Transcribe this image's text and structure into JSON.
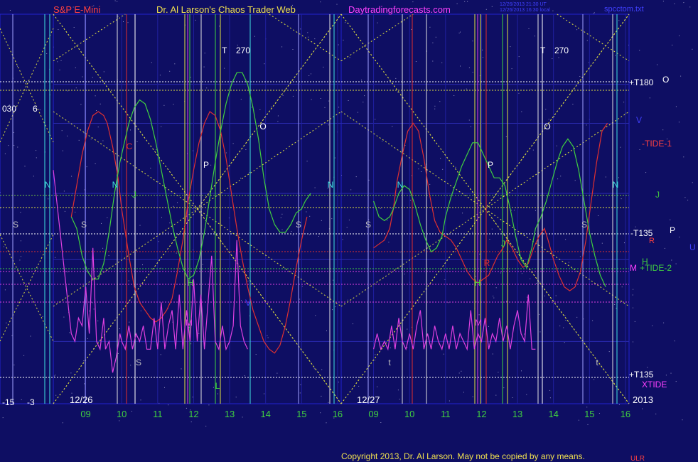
{
  "header": {
    "brand": "S&P E-Mini",
    "site_title": "Dr. Al Larson's Chaos Trader Web",
    "site_url": "Daytradingforecasts.com",
    "stamp_line1": "12/26/2013 21:30 UT",
    "stamp_line2": "12/26/2013 16:30 local",
    "file_name": "spcctom.txt"
  },
  "footer": {
    "copyright": "Copyright 2013, Dr. Al Larson. May not be copied by any means.",
    "tag": "ULR"
  },
  "colors": {
    "background": "#0e0e63",
    "grid_green": "#2a7a2a",
    "frame_blue": "#2222d0",
    "red_line": "#e03030",
    "green_line": "#40d040",
    "magenta_line": "#e040e0",
    "yellow_dotted": "#e0e040"
  },
  "chart_data": {
    "type": "line",
    "x_tick_labels": [
      "09",
      "10",
      "11",
      "12",
      "13",
      "14",
      "15",
      "16",
      "09",
      "10",
      "11",
      "12",
      "13",
      "14",
      "15",
      "16"
    ],
    "date_labels": [
      "12/26",
      "12/27"
    ],
    "year_label": "2013",
    "left_panel_labels": [
      "030",
      "6",
      "-15",
      "-3"
    ],
    "right_labels": {
      "t180": "+T180",
      "t180_letter": "O",
      "v": "V",
      "tide1": "-TIDE-1",
      "j": "J",
      "t135": "-T135",
      "t135_letter": "P",
      "r": "R",
      "u": "U",
      "h": "H",
      "m": "M",
      "tide2": "+TIDE-2",
      "t135_lower": "+T135",
      "xtide": "XTIDE"
    },
    "top_labels": [
      {
        "letter": "T",
        "value": "270"
      },
      {
        "letter": "T",
        "value": "270"
      }
    ],
    "letter_markers": [
      "C",
      "N",
      "N",
      "N",
      "N",
      "N",
      "S",
      "S",
      "S",
      "S",
      "S",
      "S",
      "P",
      "P",
      "O",
      "O",
      "J",
      "J",
      "H",
      "H",
      "M",
      "M",
      "V",
      "t",
      "t",
      "R",
      "L"
    ],
    "series": [
      {
        "color": "red",
        "points": [
          [
            8.6,
            0.52
          ],
          [
            8.75,
            0.44
          ],
          [
            8.9,
            0.36
          ],
          [
            9.05,
            0.3
          ],
          [
            9.2,
            0.26
          ],
          [
            9.35,
            0.25
          ],
          [
            9.5,
            0.26
          ],
          [
            9.6,
            0.28
          ],
          [
            9.75,
            0.34
          ],
          [
            9.9,
            0.42
          ],
          [
            10.0,
            0.5
          ],
          [
            10.1,
            0.56
          ],
          [
            10.2,
            0.62
          ],
          [
            10.35,
            0.7
          ],
          [
            10.5,
            0.74
          ],
          [
            10.65,
            0.76
          ],
          [
            10.8,
            0.78
          ],
          [
            10.95,
            0.79
          ],
          [
            11.1,
            0.78
          ],
          [
            11.25,
            0.76
          ],
          [
            11.4,
            0.73
          ],
          [
            11.55,
            0.66
          ],
          [
            11.7,
            0.58
          ],
          [
            11.85,
            0.48
          ],
          [
            12.0,
            0.4
          ],
          [
            12.15,
            0.33
          ],
          [
            12.3,
            0.28
          ],
          [
            12.45,
            0.25
          ],
          [
            12.6,
            0.26
          ],
          [
            12.75,
            0.3
          ],
          [
            12.9,
            0.37
          ],
          [
            13.05,
            0.46
          ],
          [
            13.2,
            0.55
          ],
          [
            13.35,
            0.63
          ],
          [
            13.5,
            0.7
          ],
          [
            13.65,
            0.76
          ],
          [
            13.8,
            0.8
          ],
          [
            13.95,
            0.84
          ],
          [
            14.1,
            0.86
          ],
          [
            14.25,
            0.87
          ],
          [
            14.4,
            0.85
          ],
          [
            14.55,
            0.8
          ],
          [
            14.7,
            0.73
          ],
          [
            14.85,
            0.65
          ],
          [
            15.0,
            0.58
          ],
          [
            15.15,
            0.52
          ]
        ]
      },
      {
        "color": "red",
        "points": [
          [
            9.0,
            0.6
          ],
          [
            9.15,
            0.59
          ],
          [
            9.3,
            0.58
          ],
          [
            9.45,
            0.55
          ],
          [
            9.55,
            0.5
          ],
          [
            9.65,
            0.43
          ],
          [
            9.8,
            0.36
          ],
          [
            9.95,
            0.3
          ],
          [
            10.1,
            0.28
          ],
          [
            10.25,
            0.3
          ],
          [
            10.4,
            0.37
          ],
          [
            10.55,
            0.46
          ],
          [
            10.7,
            0.53
          ],
          [
            10.85,
            0.56
          ],
          [
            11.0,
            0.57
          ],
          [
            11.15,
            0.58
          ],
          [
            11.3,
            0.6
          ],
          [
            11.45,
            0.63
          ],
          [
            11.6,
            0.66
          ],
          [
            11.75,
            0.68
          ],
          [
            11.9,
            0.69
          ],
          [
            12.05,
            0.68
          ],
          [
            12.2,
            0.67
          ],
          [
            12.3,
            0.65
          ],
          [
            12.45,
            0.62
          ],
          [
            12.6,
            0.6
          ],
          [
            12.7,
            0.58
          ],
          [
            12.85,
            0.6
          ],
          [
            13.0,
            0.63
          ],
          [
            13.15,
            0.65
          ],
          [
            13.3,
            0.64
          ],
          [
            13.45,
            0.6
          ],
          [
            13.6,
            0.57
          ],
          [
            13.75,
            0.55
          ],
          [
            13.85,
            0.58
          ],
          [
            14.0,
            0.63
          ],
          [
            14.15,
            0.67
          ],
          [
            14.3,
            0.7
          ],
          [
            14.45,
            0.71
          ],
          [
            14.6,
            0.7
          ],
          [
            14.75,
            0.66
          ],
          [
            14.9,
            0.58
          ],
          [
            15.05,
            0.48
          ],
          [
            15.2,
            0.38
          ],
          [
            15.35,
            0.3
          ],
          [
            15.5,
            0.28
          ]
        ]
      },
      {
        "color": "green",
        "points": [
          [
            8.6,
            0.52
          ],
          [
            8.75,
            0.55
          ],
          [
            8.9,
            0.62
          ],
          [
            9.05,
            0.66
          ],
          [
            9.2,
            0.68
          ],
          [
            9.35,
            0.68
          ],
          [
            9.5,
            0.64
          ],
          [
            9.65,
            0.56
          ],
          [
            9.8,
            0.46
          ],
          [
            9.95,
            0.38
          ],
          [
            10.05,
            0.34
          ],
          [
            10.2,
            0.28
          ],
          [
            10.35,
            0.24
          ],
          [
            10.5,
            0.22
          ],
          [
            10.65,
            0.23
          ],
          [
            10.8,
            0.27
          ],
          [
            10.95,
            0.33
          ],
          [
            11.1,
            0.4
          ],
          [
            11.25,
            0.47
          ],
          [
            11.4,
            0.54
          ],
          [
            11.55,
            0.6
          ],
          [
            11.7,
            0.65
          ],
          [
            11.85,
            0.68
          ],
          [
            12.0,
            0.67
          ],
          [
            12.15,
            0.63
          ],
          [
            12.3,
            0.56
          ],
          [
            12.45,
            0.47
          ],
          [
            12.6,
            0.38
          ],
          [
            12.75,
            0.3
          ],
          [
            12.9,
            0.23
          ],
          [
            13.05,
            0.18
          ],
          [
            13.2,
            0.15
          ],
          [
            13.35,
            0.15
          ],
          [
            13.5,
            0.18
          ],
          [
            13.65,
            0.24
          ],
          [
            13.8,
            0.32
          ],
          [
            13.95,
            0.42
          ],
          [
            14.1,
            0.5
          ],
          [
            14.25,
            0.54
          ],
          [
            14.4,
            0.56
          ],
          [
            14.55,
            0.56
          ],
          [
            14.7,
            0.54
          ],
          [
            14.85,
            0.51
          ],
          [
            15.0,
            0.5
          ],
          [
            15.1,
            0.48
          ],
          [
            15.25,
            0.46
          ]
        ]
      },
      {
        "color": "green",
        "points": [
          [
            9.0,
            0.48
          ],
          [
            9.15,
            0.52
          ],
          [
            9.3,
            0.53
          ],
          [
            9.45,
            0.52
          ],
          [
            9.55,
            0.5
          ],
          [
            9.7,
            0.46
          ],
          [
            9.85,
            0.44
          ],
          [
            10.0,
            0.45
          ],
          [
            10.15,
            0.49
          ],
          [
            10.3,
            0.54
          ],
          [
            10.45,
            0.58
          ],
          [
            10.6,
            0.61
          ],
          [
            10.75,
            0.6
          ],
          [
            10.9,
            0.57
          ],
          [
            11.0,
            0.52
          ],
          [
            11.15,
            0.47
          ],
          [
            11.3,
            0.43
          ],
          [
            11.45,
            0.39
          ],
          [
            11.6,
            0.36
          ],
          [
            11.75,
            0.33
          ],
          [
            11.9,
            0.33
          ],
          [
            12.05,
            0.36
          ],
          [
            12.2,
            0.39
          ],
          [
            12.35,
            0.42
          ],
          [
            12.5,
            0.42
          ],
          [
            12.65,
            0.44
          ],
          [
            12.8,
            0.5
          ],
          [
            12.95,
            0.57
          ],
          [
            13.1,
            0.63
          ],
          [
            13.25,
            0.65
          ],
          [
            13.4,
            0.6
          ],
          [
            13.5,
            0.55
          ],
          [
            13.65,
            0.52
          ],
          [
            13.8,
            0.48
          ],
          [
            13.95,
            0.43
          ],
          [
            14.1,
            0.38
          ],
          [
            14.25,
            0.34
          ],
          [
            14.4,
            0.32
          ],
          [
            14.55,
            0.34
          ],
          [
            14.7,
            0.4
          ],
          [
            14.85,
            0.48
          ],
          [
            15.0,
            0.56
          ],
          [
            15.15,
            0.62
          ],
          [
            15.3,
            0.67
          ],
          [
            15.45,
            0.7
          ]
        ]
      },
      {
        "color": "magenta",
        "points": [
          [
            8.0,
            0.4
          ],
          [
            8.6,
            0.82
          ],
          [
            8.7,
            0.84
          ],
          [
            8.8,
            0.78
          ],
          [
            8.9,
            0.8
          ],
          [
            9.0,
            0.7
          ],
          [
            9.1,
            0.82
          ],
          [
            9.2,
            0.6
          ],
          [
            9.3,
            0.84
          ],
          [
            9.4,
            0.86
          ],
          [
            9.5,
            0.78
          ],
          [
            9.55,
            0.86
          ],
          [
            9.65,
            0.84
          ],
          [
            9.75,
            0.92
          ],
          [
            9.85,
            0.88
          ],
          [
            9.95,
            0.82
          ],
          [
            10.0,
            0.84
          ],
          [
            10.1,
            0.86
          ],
          [
            10.2,
            0.8
          ],
          [
            10.3,
            0.86
          ],
          [
            10.4,
            0.82
          ],
          [
            10.5,
            0.84
          ],
          [
            10.6,
            0.8
          ],
          [
            10.7,
            0.86
          ],
          [
            10.8,
            0.86
          ],
          [
            10.9,
            0.78
          ],
          [
            11.0,
            0.86
          ],
          [
            11.1,
            0.74
          ],
          [
            11.2,
            0.86
          ],
          [
            11.3,
            0.8
          ],
          [
            11.4,
            0.76
          ],
          [
            11.5,
            0.86
          ],
          [
            11.6,
            0.72
          ],
          [
            11.7,
            0.86
          ],
          [
            11.8,
            0.76
          ],
          [
            11.9,
            0.84
          ],
          [
            12.0,
            0.68
          ],
          [
            12.1,
            0.84
          ],
          [
            12.2,
            0.72
          ],
          [
            12.3,
            0.86
          ],
          [
            12.4,
            0.74
          ],
          [
            12.5,
            0.62
          ],
          [
            12.6,
            0.84
          ],
          [
            12.7,
            0.86
          ],
          [
            12.8,
            0.8
          ],
          [
            12.9,
            0.86
          ],
          [
            13.0,
            0.84
          ],
          [
            13.1,
            0.8
          ],
          [
            13.2,
            0.58
          ],
          [
            13.3,
            0.8
          ],
          [
            13.4,
            0.84
          ],
          [
            13.5,
            0.86
          ]
        ]
      },
      {
        "color": "magenta",
        "points": [
          [
            9.0,
            0.86
          ],
          [
            9.1,
            0.82
          ],
          [
            9.2,
            0.86
          ],
          [
            9.3,
            0.84
          ],
          [
            9.4,
            0.86
          ],
          [
            9.5,
            0.8
          ],
          [
            9.6,
            0.86
          ],
          [
            9.7,
            0.78
          ],
          [
            9.8,
            0.84
          ],
          [
            9.9,
            0.86
          ],
          [
            10.0,
            0.82
          ],
          [
            10.1,
            0.86
          ],
          [
            10.2,
            0.8
          ],
          [
            10.3,
            0.76
          ],
          [
            10.4,
            0.86
          ],
          [
            10.5,
            0.82
          ],
          [
            10.6,
            0.86
          ],
          [
            10.7,
            0.8
          ],
          [
            10.8,
            0.84
          ],
          [
            10.9,
            0.86
          ],
          [
            11.0,
            0.82
          ],
          [
            11.1,
            0.86
          ],
          [
            11.2,
            0.8
          ],
          [
            11.3,
            0.86
          ],
          [
            11.4,
            0.82
          ],
          [
            11.5,
            0.84
          ],
          [
            11.6,
            0.86
          ],
          [
            11.7,
            0.76
          ],
          [
            11.8,
            0.86
          ],
          [
            11.9,
            0.82
          ],
          [
            12.0,
            0.84
          ],
          [
            12.1,
            0.78
          ],
          [
            12.2,
            0.86
          ],
          [
            12.3,
            0.82
          ],
          [
            12.4,
            0.84
          ],
          [
            12.5,
            0.78
          ],
          [
            12.6,
            0.84
          ],
          [
            12.7,
            0.8
          ],
          [
            12.8,
            0.86
          ],
          [
            12.9,
            0.8
          ],
          [
            13.0,
            0.76
          ],
          [
            13.1,
            0.82
          ],
          [
            13.2,
            0.84
          ],
          [
            13.3,
            0.72
          ],
          [
            13.4,
            0.86
          ],
          [
            13.5,
            0.86
          ]
        ]
      }
    ]
  }
}
